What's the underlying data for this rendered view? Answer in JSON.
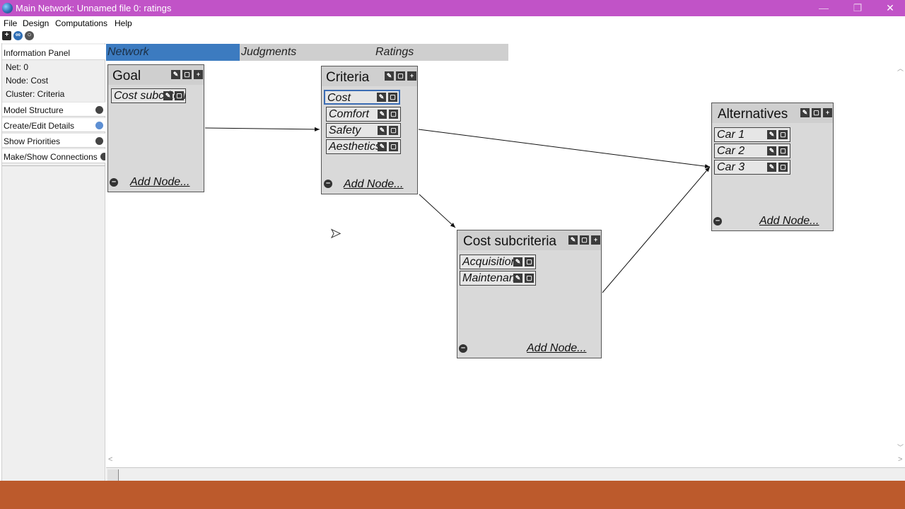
{
  "window": {
    "title": "Main Network: Unnamed file 0: ratings",
    "controls": {
      "minimize": "—",
      "maximize": "❐",
      "close": "✕"
    }
  },
  "menu": {
    "items": [
      "File",
      "Design",
      "Computations",
      "Help"
    ]
  },
  "toolbar": {
    "icons": [
      "add-icon",
      "link-icon",
      "zoom-icon"
    ]
  },
  "left_panel": {
    "header": "Information Panel",
    "info": {
      "net": "Net: 0",
      "node": "Node: Cost",
      "cluster": "Cluster: Criteria"
    },
    "sections": [
      "Model Structure",
      "Create/Edit Details",
      "Show Priorities",
      "Make/Show Connections"
    ]
  },
  "tabs": [
    {
      "label": "Network",
      "active": true
    },
    {
      "label": "Judgments",
      "active": false
    },
    {
      "label": "Ratings",
      "active": false
    }
  ],
  "clusters": {
    "goal": {
      "title": "Goal",
      "nodes": [
        "Cost subcriteria"
      ],
      "add_label": "Add Node..."
    },
    "criteria": {
      "title": "Criteria",
      "nodes": [
        "Cost",
        "Comfort",
        "Safety",
        "Aesthetics"
      ],
      "selected": "Cost",
      "add_label": "Add Node..."
    },
    "alternatives": {
      "title": "Alternatives",
      "nodes": [
        "Car 1",
        "Car 2",
        "Car 3"
      ],
      "add_label": "Add Node..."
    },
    "cost_sub": {
      "title": "Cost subcriteria",
      "nodes": [
        "Acquisition",
        "Maintenance"
      ],
      "add_label": "Add Node..."
    }
  },
  "colors": {
    "titlebar": "#c153c7",
    "active_tab": "#3c7bc0",
    "taskbar": "#bc5a2c",
    "cluster_bg": "#d9d9d9"
  }
}
